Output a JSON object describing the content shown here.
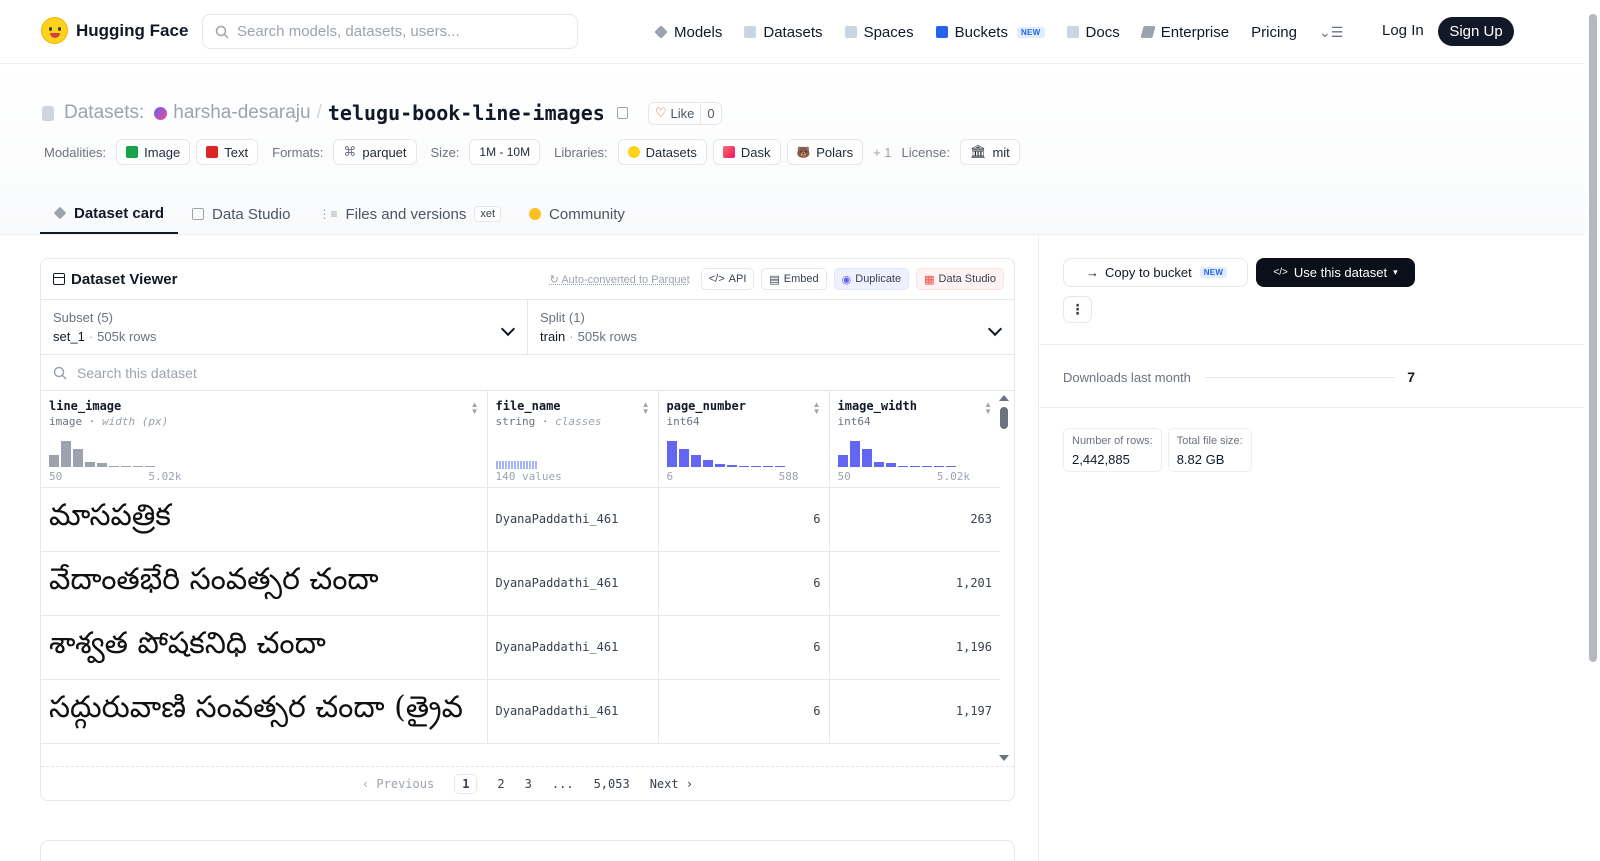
{
  "nav": {
    "brand": "Hugging Face",
    "search_placeholder": "Search models, datasets, users...",
    "links": [
      {
        "label": "Models",
        "icon": "models-icon",
        "color": "#9ca3af"
      },
      {
        "label": "Datasets",
        "icon": "datasets-icon",
        "color": "#cbd5e1"
      },
      {
        "label": "Spaces",
        "icon": "spaces-icon",
        "color": "#cbd5e1"
      },
      {
        "label": "Buckets",
        "icon": "buckets-icon",
        "color": "#2563eb",
        "badge": "NEW"
      },
      {
        "label": "Docs",
        "icon": "docs-icon",
        "color": "#cbd5e1"
      },
      {
        "label": "Enterprise",
        "icon": "enterprise-icon",
        "color": "#9ca3af"
      },
      {
        "label": "Pricing"
      }
    ],
    "login": "Log In",
    "signup": "Sign Up"
  },
  "header": {
    "section_label": "Datasets:",
    "owner": "harsha-desaraju",
    "separator": "/",
    "repo": "telugu-book-line-images",
    "like_label": "Like",
    "like_count": "0",
    "modalities_label": "Modalities:",
    "modalities": [
      "Image",
      "Text"
    ],
    "formats_label": "Formats:",
    "format": "parquet",
    "size_label": "Size:",
    "size": "1M - 10M",
    "libraries_label": "Libraries:",
    "libraries": [
      "Datasets",
      "Dask",
      "Polars"
    ],
    "libraries_more": "+ 1",
    "license_label": "License:",
    "license": "mit"
  },
  "tabs": [
    {
      "label": "Dataset card",
      "active": true
    },
    {
      "label": "Data Studio"
    },
    {
      "label": "Files and versions",
      "badge": "xet"
    },
    {
      "label": "Community"
    }
  ],
  "viewer": {
    "title": "Dataset Viewer",
    "auto_converted": "Auto-converted to Parquet",
    "api": "API",
    "embed": "Embed",
    "duplicate": "Duplicate",
    "data_studio": "Data Studio",
    "subset_label": "Subset (5)",
    "subset_value": "set_1",
    "subset_rows": "505k rows",
    "split_label": "Split (1)",
    "split_value": "train",
    "split_rows": "505k rows",
    "search_placeholder": "Search this dataset",
    "columns": [
      {
        "name": "line_image",
        "type": "image",
        "sub": "width (px)",
        "min": "50",
        "max": "5.02k",
        "hist": [
          0.45,
          1.0,
          0.7,
          0.2,
          0.15,
          0.05,
          0.05,
          0.05,
          0.05
        ],
        "hist_color": "#9ca3af"
      },
      {
        "name": "file_name",
        "type": "string",
        "sub": "classes",
        "values_count": "140 values"
      },
      {
        "name": "page_number",
        "type": "int64",
        "min": "6",
        "max": "588",
        "hist": [
          1.0,
          0.7,
          0.45,
          0.25,
          0.12,
          0.07,
          0.05,
          0.04,
          0.03,
          0.03
        ],
        "hist_color": "#6366f1"
      },
      {
        "name": "image_width",
        "type": "int64",
        "min": "50",
        "max": "5.02k",
        "hist": [
          0.45,
          1.0,
          0.7,
          0.2,
          0.15,
          0.05,
          0.05,
          0.05,
          0.05,
          0.05
        ],
        "hist_color": "#6366f1"
      }
    ],
    "rows": [
      {
        "line_image": "మాసపత్రిక",
        "file_name": "DyanaPaddathi_461",
        "page_number": "6",
        "image_width": "263"
      },
      {
        "line_image": "వేదాంతభేరి సంవత్సర చందా",
        "file_name": "DyanaPaddathi_461",
        "page_number": "6",
        "image_width": "1,201"
      },
      {
        "line_image": "శాశ్వత పోషకనిధి చందా",
        "file_name": "DyanaPaddathi_461",
        "page_number": "6",
        "image_width": "1,196"
      },
      {
        "line_image": "సద్గురువాణి సంవత్సర చందా (త్రైవ",
        "file_name": "DyanaPaddathi_461",
        "page_number": "6",
        "image_width": "1,197"
      }
    ],
    "pager": {
      "prev": "Previous",
      "pages": [
        "1",
        "2",
        "3",
        "...",
        "5,053"
      ],
      "next": "Next"
    }
  },
  "sidebar": {
    "copy_bucket": "Copy to bucket",
    "copy_badge": "NEW",
    "use_dataset": "Use this dataset",
    "downloads_label": "Downloads last month",
    "downloads_value": "7",
    "rows_label": "Number of rows:",
    "rows_value": "2,442,885",
    "size_label": "Total file size:",
    "size_value": "8.82 GB"
  }
}
